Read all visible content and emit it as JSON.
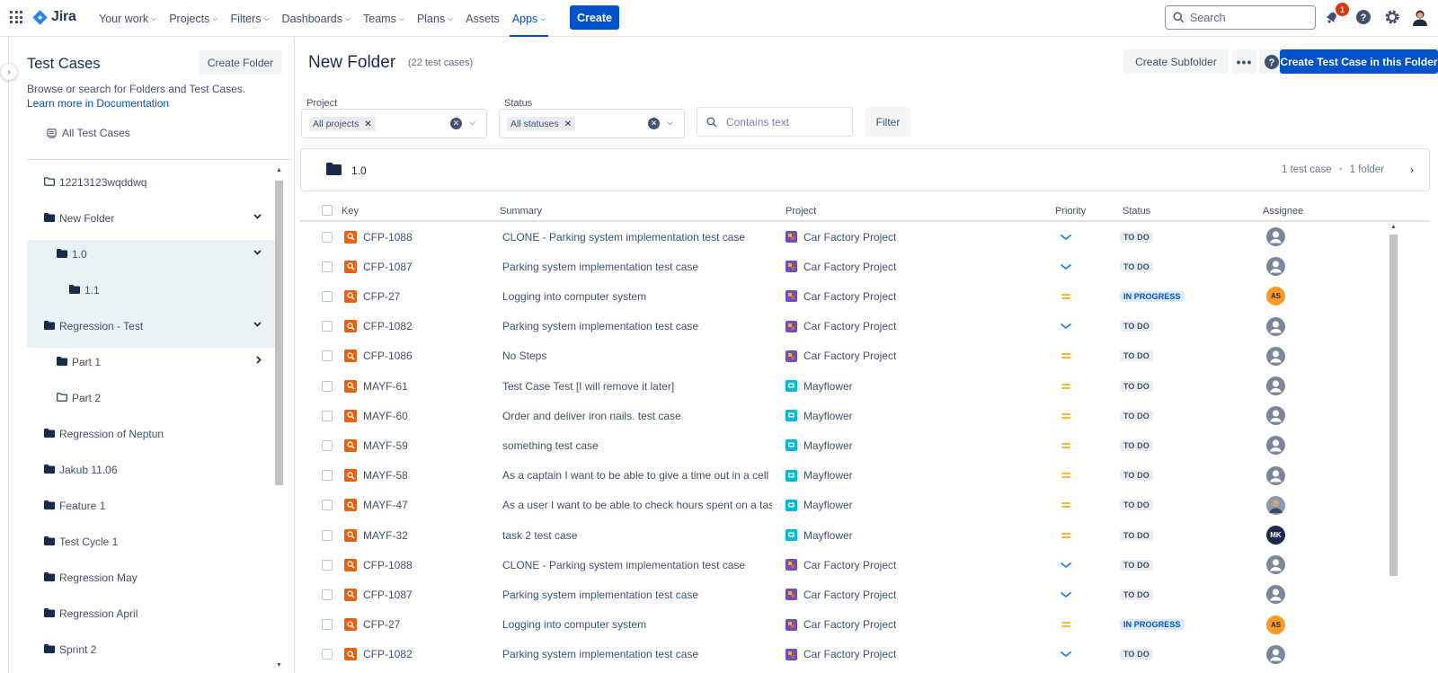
{
  "nav": {
    "logo": "Jira",
    "items": [
      {
        "label": "Your work",
        "chevron": true
      },
      {
        "label": "Projects",
        "chevron": true
      },
      {
        "label": "Filters",
        "chevron": true
      },
      {
        "label": "Dashboards",
        "chevron": true
      },
      {
        "label": "Teams",
        "chevron": true
      },
      {
        "label": "Plans",
        "chevron": true
      },
      {
        "label": "Assets",
        "chevron": false
      },
      {
        "label": "Apps",
        "chevron": true,
        "active": true
      }
    ],
    "create_label": "Create",
    "search_placeholder": "Search",
    "notification_count": "1",
    "icons": [
      "app-switcher-icon",
      "notifications-icon",
      "help-icon",
      "settings-icon",
      "profile-avatar"
    ]
  },
  "sidebar": {
    "title": "Test Cases",
    "create_folder_label": "Create Folder",
    "description": "Browse or search for Folders and Test Cases.",
    "doc_link": "Learn more in Documentation",
    "all_test_cases": "All Test Cases",
    "tree": [
      {
        "label": "12213123wqddwq",
        "level": 0,
        "filled": false,
        "caret": ""
      },
      {
        "label": "New Folder",
        "level": 0,
        "filled": true,
        "caret": "down",
        "selected": true
      },
      {
        "label": "1.0",
        "level": 1,
        "filled": true,
        "caret": "down",
        "selected": true
      },
      {
        "label": "1.1",
        "level": 2,
        "filled": true,
        "caret": "",
        "selected": true
      },
      {
        "label": "Regression - Test",
        "level": 0,
        "filled": true,
        "caret": "down"
      },
      {
        "label": "Part 1",
        "level": 1,
        "filled": true,
        "caret": "right"
      },
      {
        "label": "Part 2",
        "level": 1,
        "filled": false,
        "caret": ""
      },
      {
        "label": "Regression of Neptun",
        "level": 0,
        "filled": true,
        "caret": ""
      },
      {
        "label": "Jakub 11.06",
        "level": 0,
        "filled": true,
        "caret": ""
      },
      {
        "label": "Feature 1",
        "level": 0,
        "filled": true,
        "caret": ""
      },
      {
        "label": "Test Cycle 1",
        "level": 0,
        "filled": true,
        "caret": ""
      },
      {
        "label": "Regression May",
        "level": 0,
        "filled": true,
        "caret": ""
      },
      {
        "label": "Regression April",
        "level": 0,
        "filled": true,
        "caret": ""
      },
      {
        "label": "Sprint 2",
        "level": 0,
        "filled": true,
        "caret": ""
      }
    ]
  },
  "main": {
    "title": "New Folder",
    "count": "(22 test cases)",
    "create_subfolder_label": "Create Subfolder",
    "more_label": "•••",
    "create_test_case_label": "Create Test Case in this Folder",
    "filters": {
      "project_label": "Project",
      "project_chip": "All projects",
      "status_label": "Status",
      "status_chip": "All statuses",
      "text_placeholder": "Contains text",
      "filter_button": "Filter"
    },
    "subfolder": {
      "name": "1.0",
      "test_case_count": "1 test case",
      "separator": "•",
      "folder_count": "1 folder"
    },
    "columns": [
      "Key",
      "Summary",
      "Project",
      "Priority",
      "Status",
      "Assignee"
    ],
    "rows": [
      {
        "key": "CFP-1088",
        "summary": "CLONE - Parking system implementation test case",
        "project": "Car Factory Project",
        "project_type": "car",
        "priority": "low",
        "status": "TO DO",
        "status_type": "todo",
        "assignee": ""
      },
      {
        "key": "CFP-1087",
        "summary": "Parking system implementation test case",
        "project": "Car Factory Project",
        "project_type": "car",
        "priority": "low",
        "status": "TO DO",
        "status_type": "todo",
        "assignee": ""
      },
      {
        "key": "CFP-27",
        "summary": "Logging into computer system",
        "project": "Car Factory Project",
        "project_type": "car",
        "priority": "medium",
        "status": "IN PROGRESS",
        "status_type": "inprog",
        "assignee": "AS"
      },
      {
        "key": "CFP-1082",
        "summary": "Parking system implementation test case",
        "project": "Car Factory Project",
        "project_type": "car",
        "priority": "low",
        "status": "TO DO",
        "status_type": "todo",
        "assignee": ""
      },
      {
        "key": "CFP-1086",
        "summary": "No Steps",
        "project": "Car Factory Project",
        "project_type": "car",
        "priority": "medium",
        "status": "TO DO",
        "status_type": "todo",
        "assignee": ""
      },
      {
        "key": "MAYF-61",
        "summary": "Test Case Test [I will remove it later]",
        "project": "Mayflower",
        "project_type": "mayflower",
        "priority": "medium",
        "status": "TO DO",
        "status_type": "todo",
        "assignee": ""
      },
      {
        "key": "MAYF-60",
        "summary": "Order and deliver iron nails. test case",
        "project": "Mayflower",
        "project_type": "mayflower",
        "priority": "medium",
        "status": "TO DO",
        "status_type": "todo",
        "assignee": ""
      },
      {
        "key": "MAYF-59",
        "summary": "something test case",
        "project": "Mayflower",
        "project_type": "mayflower",
        "priority": "medium",
        "status": "TO DO",
        "status_type": "todo",
        "assignee": ""
      },
      {
        "key": "MAYF-58",
        "summary": "As a captain I want to be able to give a time out in a cell ...",
        "project": "Mayflower",
        "project_type": "mayflower",
        "priority": "medium",
        "status": "TO DO",
        "status_type": "todo",
        "assignee": ""
      },
      {
        "key": "MAYF-47",
        "summary": "As a user I want to be able to check hours spent on a tas...",
        "project": "Mayflower",
        "project_type": "mayflower",
        "priority": "medium",
        "status": "TO DO",
        "status_type": "todo",
        "assignee": "photo"
      },
      {
        "key": "MAYF-32",
        "summary": "task 2 test case",
        "project": "Mayflower",
        "project_type": "mayflower",
        "priority": "medium",
        "status": "TO DO",
        "status_type": "todo",
        "assignee": "MK"
      },
      {
        "key": "CFP-1088",
        "summary": "CLONE - Parking system implementation test case",
        "project": "Car Factory Project",
        "project_type": "car",
        "priority": "low",
        "status": "TO DO",
        "status_type": "todo",
        "assignee": ""
      },
      {
        "key": "CFP-1087",
        "summary": "Parking system implementation test case",
        "project": "Car Factory Project",
        "project_type": "car",
        "priority": "low",
        "status": "TO DO",
        "status_type": "todo",
        "assignee": ""
      },
      {
        "key": "CFP-27",
        "summary": "Logging into computer system",
        "project": "Car Factory Project",
        "project_type": "car",
        "priority": "medium",
        "status": "IN PROGRESS",
        "status_type": "inprog",
        "assignee": "AS"
      },
      {
        "key": "CFP-1082",
        "summary": "Parking system implementation test case",
        "project": "Car Factory Project",
        "project_type": "car",
        "priority": "low",
        "status": "TO DO",
        "status_type": "todo",
        "assignee": ""
      }
    ]
  },
  "colors": {
    "brand": "#0052cc",
    "issue_icon": "#e9600f",
    "priority_low": "#2684ff",
    "priority_medium": "#ffab00",
    "avatar_as": "#ff991f",
    "avatar_mk": "#172b4d"
  }
}
